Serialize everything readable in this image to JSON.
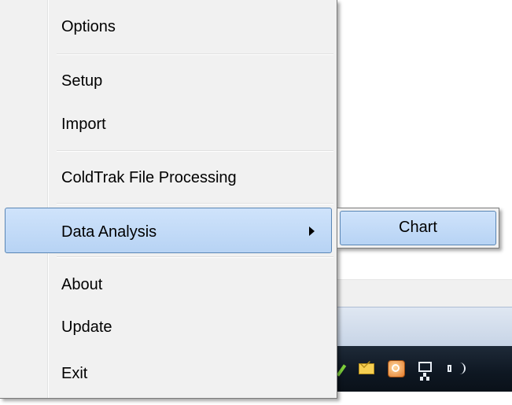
{
  "menu": {
    "items": [
      {
        "label": "Options"
      },
      {
        "label": "Setup"
      },
      {
        "label": "Import"
      },
      {
        "label": "ColdTrak File Processing"
      },
      {
        "label": "Data Analysis",
        "has_submenu": true,
        "highlighted": true
      },
      {
        "label": "About"
      },
      {
        "label": "Update"
      },
      {
        "label": "Exit"
      }
    ]
  },
  "submenu": {
    "items": [
      {
        "label": "Chart",
        "highlighted": true
      }
    ]
  },
  "tray": {
    "icons": [
      "pen-icon",
      "mail-icon",
      "clock-icon",
      "network-icon",
      "volume-icon"
    ]
  },
  "colors": {
    "highlight_fill": "#c4dcf8",
    "highlight_border": "#5a86b5",
    "menu_background": "#f1f1f1",
    "taskbar": "#0e1722"
  }
}
